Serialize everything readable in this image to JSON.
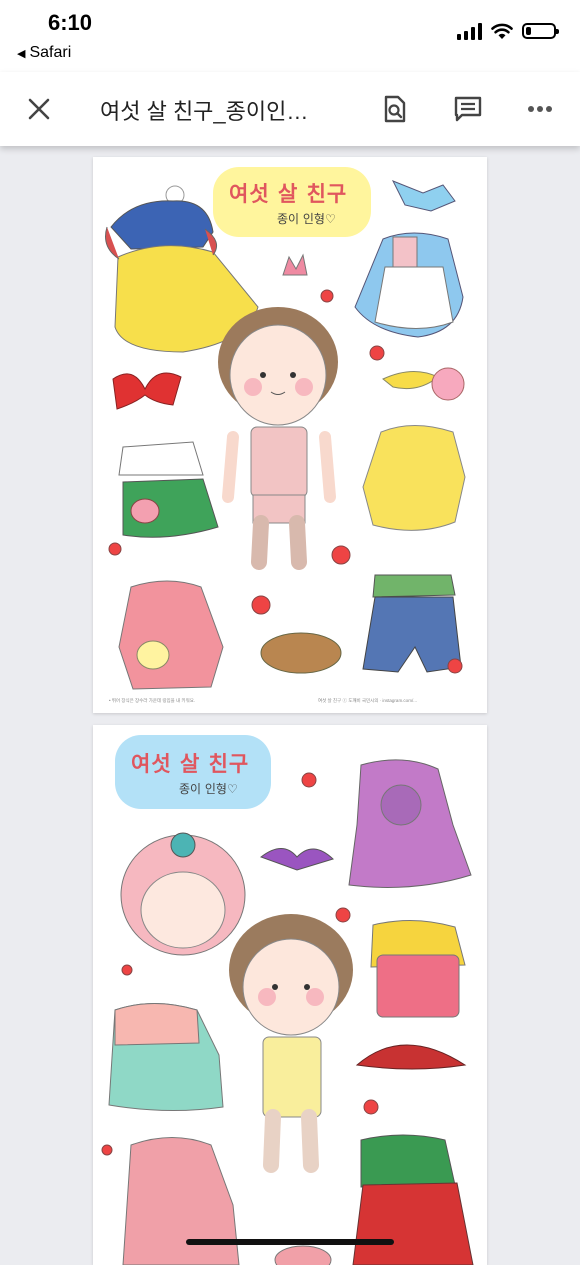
{
  "status_bar": {
    "time": "6:10",
    "back_app": "Safari",
    "icons": [
      "signal-icon",
      "wifi-icon",
      "battery-icon"
    ],
    "battery_level": 0.2
  },
  "toolbar": {
    "title": "여섯 살 친구_종이인…",
    "close_icon": "close-icon",
    "search_icon": "document-search-icon",
    "comment_icon": "comment-icon",
    "more_icon": "more-icon"
  },
  "pages": [
    {
      "badge_title": "여섯 살 친구",
      "badge_subtitle": "종이 인형♡",
      "badge_color": "#fff59d",
      "footnote_left": "• 뛰어 장식은 장수라 가운데 링입을 내 키워요.",
      "footnote_right": "여섯 살 친구 ⓒ 도깨비  국민시의 · instagram.com/..."
    },
    {
      "badge_title": "여섯 살 친구",
      "badge_subtitle": "종이 인형♡",
      "badge_color": "#b3e1f7"
    }
  ]
}
